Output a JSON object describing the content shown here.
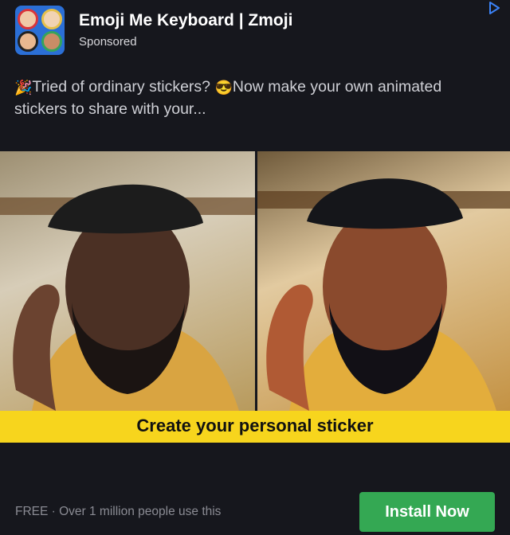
{
  "ad": {
    "app_name": "Emoji Me Keyboard | Zmoji",
    "sponsored_label": "Sponsored",
    "body_part1": "Tried of ordinary stickers? ",
    "body_part2": "Now make your own animated stickers to share with your...",
    "emoji_1": "🎉",
    "emoji_2": "😎",
    "caption": "Create your personal sticker",
    "footer_meta": "FREE · Over 1 million people use this",
    "install_label": "Install Now"
  },
  "icons": {
    "app_icon": "zmoji-app-icon",
    "adchoices": "adchoices-icon"
  },
  "colors": {
    "background": "#16171d",
    "caption_bar": "#f7d51d",
    "install_button": "#34a853",
    "adchoices": "#3b82f6"
  }
}
